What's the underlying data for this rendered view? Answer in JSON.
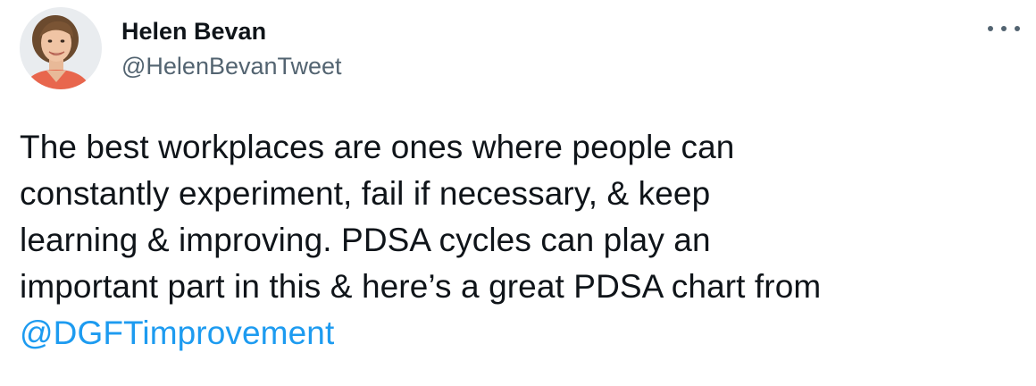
{
  "author": {
    "name": "Helen Bevan",
    "handle": "@HelenBevanTweet"
  },
  "tweet": {
    "lines": [
      "The best workplaces are ones where people can",
      "constantly experiment, fail if necessary, & keep",
      "learning & improving. PDSA cycles can play an",
      "important part in this & here’s a great PDSA chart from"
    ],
    "mention": "@DGFTimprovement"
  },
  "icons": {
    "more": "more-options-icon",
    "avatar": "profile-photo"
  },
  "colors": {
    "text": "#0f1419",
    "secondary": "#536471",
    "link": "#1d9bf0"
  }
}
